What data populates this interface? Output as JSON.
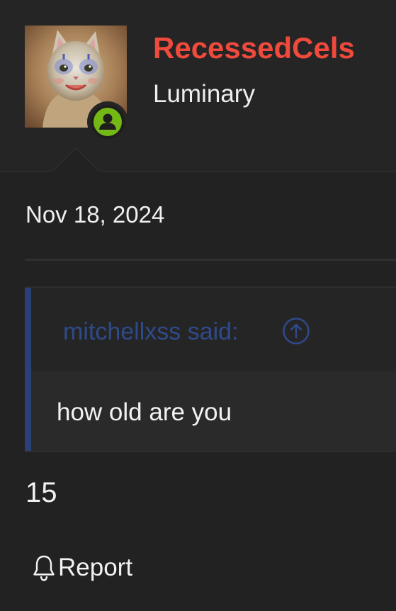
{
  "user": {
    "name": "RecessedCels",
    "title": "Luminary",
    "status": "online",
    "name_color": "#ef4a3c",
    "status_color": "#74b816"
  },
  "post": {
    "date": "Nov 18, 2024",
    "quote": {
      "author_line": "mitchellxss said:",
      "text": "how old are you",
      "accent_color": "#2a4177"
    },
    "message": "15",
    "actions": {
      "report_label": "Report",
      "report_icon": "bell-icon",
      "jump_icon": "arrow-up-circle-icon"
    }
  }
}
